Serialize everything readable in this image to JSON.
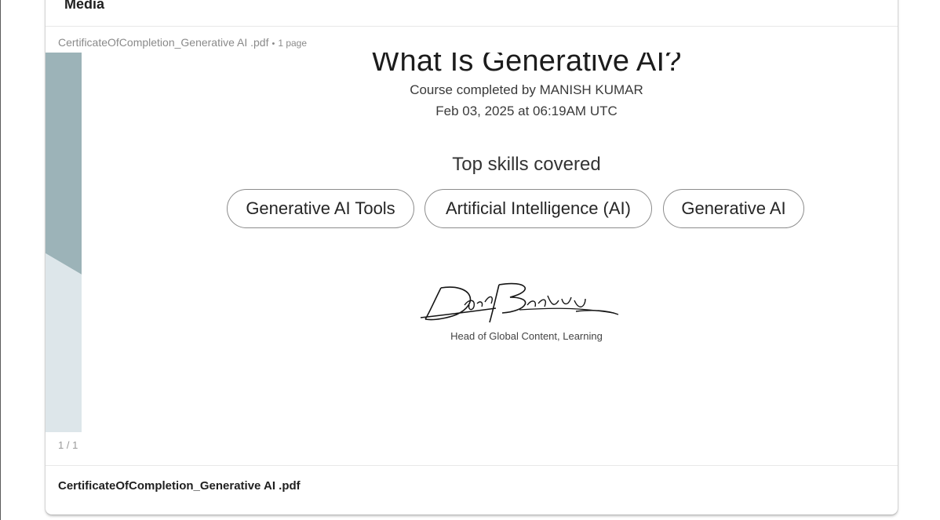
{
  "section": {
    "title": "Media"
  },
  "document": {
    "file_name": "CertificateOfCompletion_Generative AI .pdf",
    "separator": "•",
    "page_count_label": "1 page",
    "page_indicator": "1 / 1"
  },
  "certificate": {
    "title": "What Is Generative AI?",
    "completed_by": "Course completed by MANISH KUMAR",
    "date": "Feb 03, 2025 at 06:19AM UTC",
    "skills_heading": "Top skills covered",
    "skills": [
      "Generative AI Tools",
      "Artificial Intelligence (AI)",
      "Generative AI"
    ],
    "signature_caption": "Head of Global Content, Learning"
  },
  "colors": {
    "stripe_dark": "#9cb3b8",
    "stripe_light": "#dde6ea"
  }
}
